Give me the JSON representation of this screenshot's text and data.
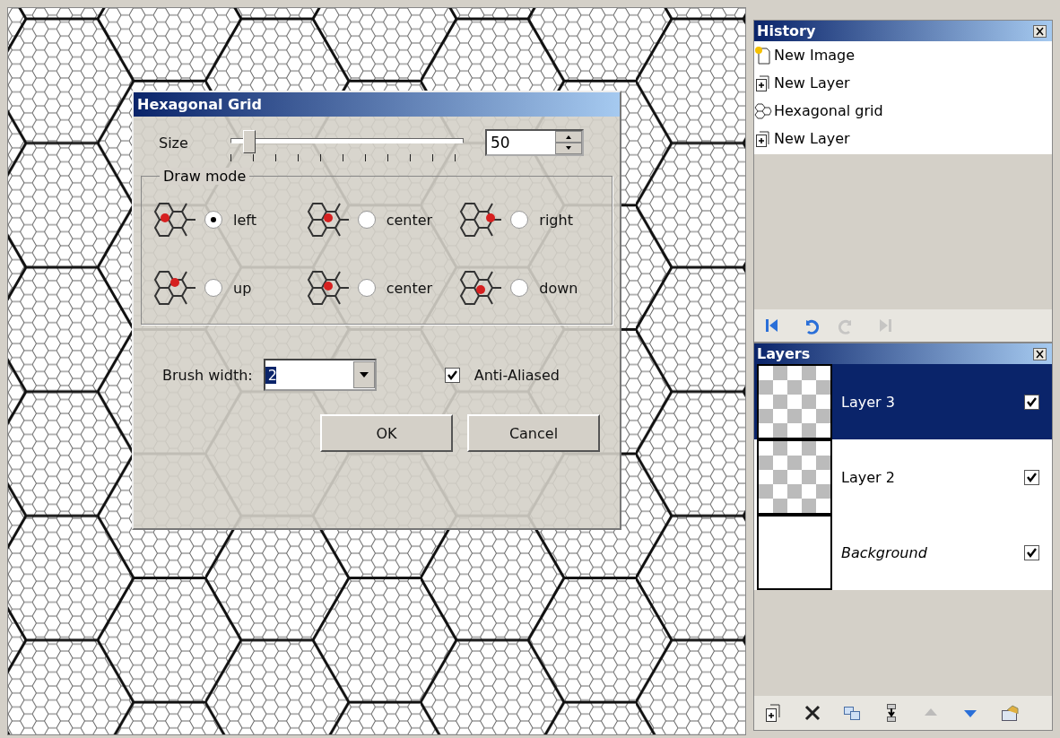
{
  "dialog": {
    "title": "Hexagonal Grid",
    "size": {
      "label": "Size",
      "level": 0.05,
      "value": "50"
    },
    "draw_mode": {
      "legend": "Draw mode",
      "options": [
        {
          "label": "left",
          "selected": true
        },
        {
          "label": "center",
          "selected": false
        },
        {
          "label": "right",
          "selected": false
        },
        {
          "label": "up",
          "selected": false
        },
        {
          "label": "center",
          "selected": false
        },
        {
          "label": "down",
          "selected": false
        }
      ]
    },
    "brush_width": {
      "label": "Brush width:",
      "value": "2"
    },
    "anti_aliased": {
      "label": "Anti-Aliased",
      "checked": true
    },
    "buttons": [
      "OK",
      "Cancel"
    ]
  },
  "history": {
    "title": "History",
    "items": [
      {
        "label": "New Image",
        "kind": "new_image"
      },
      {
        "label": "New Layer",
        "kind": "new_layer"
      },
      {
        "label": "Hexagonal grid",
        "kind": "hex_grid"
      },
      {
        "label": "New Layer",
        "kind": "new_layer"
      }
    ],
    "toolbar": [
      {
        "disabled": false
      },
      {
        "disabled": false
      },
      {
        "disabled": true
      },
      {
        "disabled": true
      }
    ]
  },
  "layers": {
    "title": "Layers",
    "items": [
      {
        "label": "Layer 3",
        "kind": "layer",
        "selected": true,
        "visible": true
      },
      {
        "label": "Layer 2",
        "kind": "layer",
        "selected": false,
        "visible": true
      },
      {
        "label": "Background",
        "kind": "background",
        "selected": false,
        "visible": true
      }
    ],
    "toolbar": [
      {
        "disabled": false
      },
      {
        "disabled": false
      },
      {
        "disabled": false
      },
      {
        "disabled": false
      },
      {
        "disabled": true
      },
      {
        "disabled": false
      },
      {
        "disabled": false
      }
    ]
  }
}
